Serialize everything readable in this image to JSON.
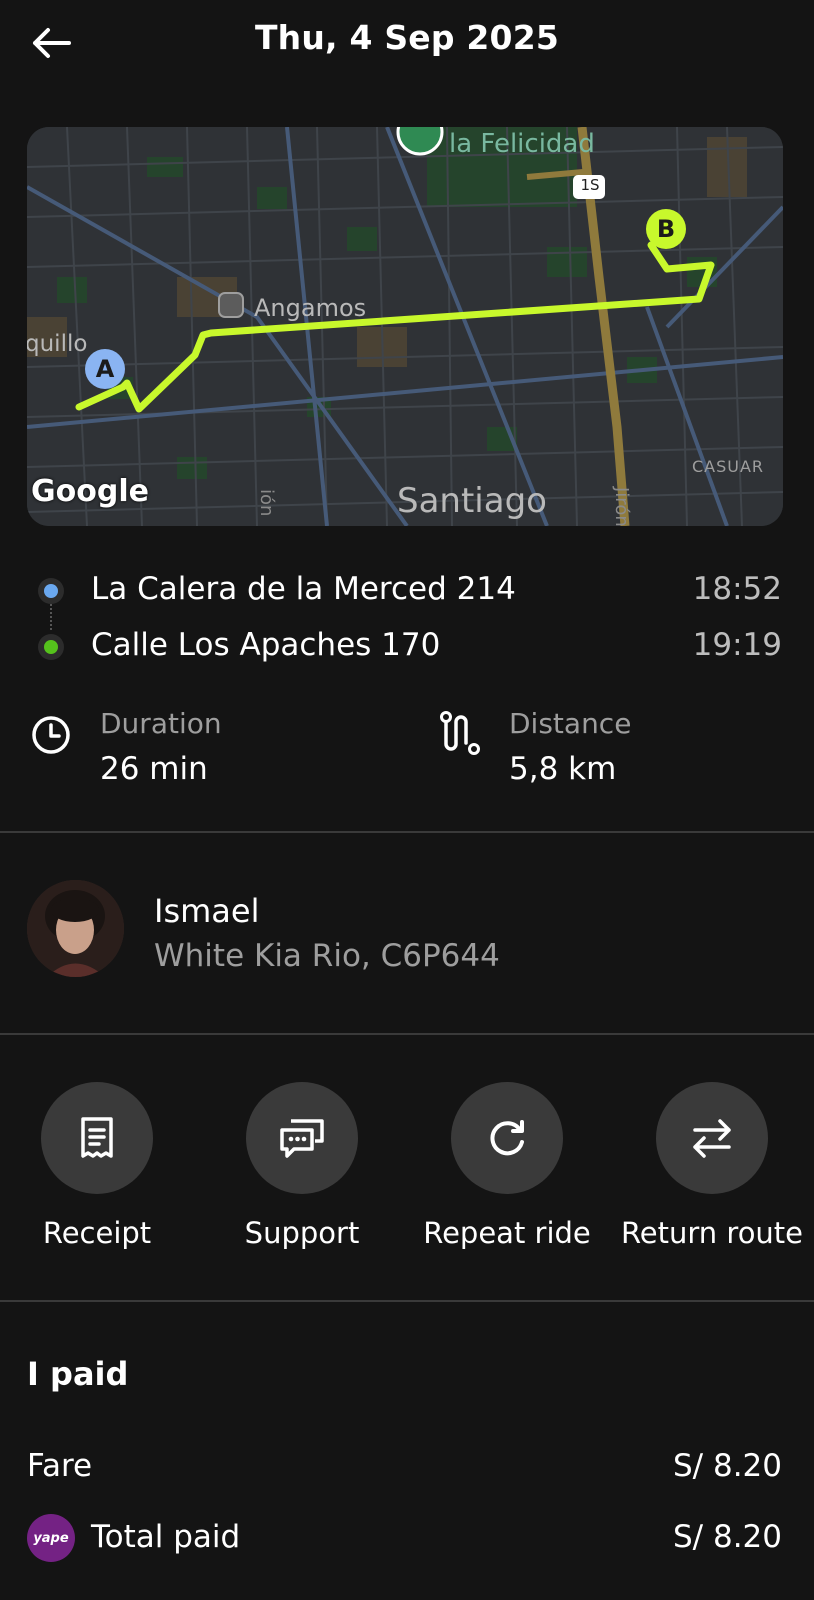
{
  "header": {
    "title": "Thu, 4 Sep 2025",
    "back_icon": "arrow-left-icon"
  },
  "map": {
    "attribution": "Google",
    "labels": {
      "park": "la Felicidad",
      "station": "Angamos",
      "district_left": "quillo",
      "city": "Santiago",
      "road_badge": "1S",
      "casuar": "CASUAR",
      "jiron": "Jirón",
      "vertical_left": "ión"
    },
    "marker_a": "A",
    "marker_b": "B",
    "route_color": "#c8f82c"
  },
  "route": {
    "pickup": {
      "address": "La Calera de la Merced 214",
      "time": "18:52",
      "color": "#6aa8ef"
    },
    "dropoff": {
      "address": "Calle Los Apaches 170",
      "time": "19:19",
      "color": "#55c21c"
    }
  },
  "stats": {
    "duration": {
      "label": "Duration",
      "value": "26 min",
      "icon": "clock-icon"
    },
    "distance": {
      "label": "Distance",
      "value": "5,8 km",
      "icon": "route-icon"
    }
  },
  "driver": {
    "name": "Ismael",
    "car": "White Kia Rio, C6P644"
  },
  "actions": [
    {
      "label": "Receipt",
      "icon": "receipt-icon"
    },
    {
      "label": "Support",
      "icon": "chat-icon"
    },
    {
      "label": "Repeat ride",
      "icon": "refresh-icon"
    },
    {
      "label": "Return route",
      "icon": "swap-arrows-icon"
    }
  ],
  "payment": {
    "title": "I paid",
    "fare_label": "Fare",
    "fare_amount": "S/ 8.20",
    "total_label": "Total paid",
    "total_amount": "S/ 8.20",
    "method_logo_text": "yape",
    "method_color": "#742284"
  }
}
